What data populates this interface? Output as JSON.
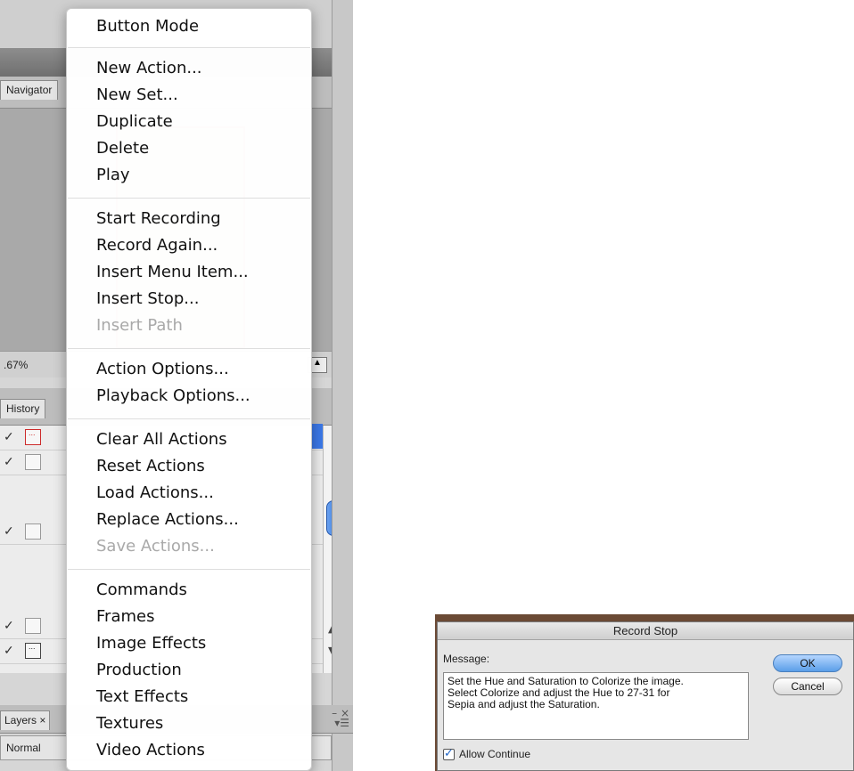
{
  "panels": {
    "navigator_tab": "Navigator",
    "zoom_value": ".67%",
    "history_tab": "History",
    "layers_tab": "Layers ×",
    "blend_mode": "Normal",
    "dock_arrows_icon": "double-chevron-right-icon",
    "panel_menu_icon": "panel-menu-icon"
  },
  "menu": {
    "items": [
      {
        "label": "Button Mode",
        "disabled": false
      },
      {
        "label": "New Action...",
        "disabled": false
      },
      {
        "label": "New Set...",
        "disabled": false
      },
      {
        "label": "Duplicate",
        "disabled": false
      },
      {
        "label": "Delete",
        "disabled": false
      },
      {
        "label": "Play",
        "disabled": false
      },
      {
        "label": "Start Recording",
        "disabled": false
      },
      {
        "label": "Record Again...",
        "disabled": false
      },
      {
        "label": "Insert Menu Item...",
        "disabled": false
      },
      {
        "label": "Insert Stop...",
        "disabled": false
      },
      {
        "label": "Insert Path",
        "disabled": true
      },
      {
        "label": "Action Options...",
        "disabled": false
      },
      {
        "label": "Playback Options...",
        "disabled": false
      },
      {
        "label": "Clear All Actions",
        "disabled": false
      },
      {
        "label": "Reset Actions",
        "disabled": false
      },
      {
        "label": "Load Actions...",
        "disabled": false
      },
      {
        "label": "Replace Actions...",
        "disabled": false
      },
      {
        "label": "Save Actions...",
        "disabled": true
      },
      {
        "label": "Commands",
        "disabled": false
      },
      {
        "label": "Frames",
        "disabled": false
      },
      {
        "label": "Image Effects",
        "disabled": false
      },
      {
        "label": "Production",
        "disabled": false
      },
      {
        "label": "Text Effects",
        "disabled": false
      },
      {
        "label": "Textures",
        "disabled": false
      },
      {
        "label": "Video Actions",
        "disabled": false
      }
    ]
  },
  "dialog": {
    "title": "Record Stop",
    "message_label": "Message:",
    "message": "Set the Hue and Saturation to Colorize the image.\nSelect Colorize and adjust the Hue to 27-31 for\nSepia and adjust the Saturation.",
    "ok_label": "OK",
    "cancel_label": "Cancel",
    "allow_continue_label": "Allow Continue",
    "allow_continue_checked": true
  }
}
